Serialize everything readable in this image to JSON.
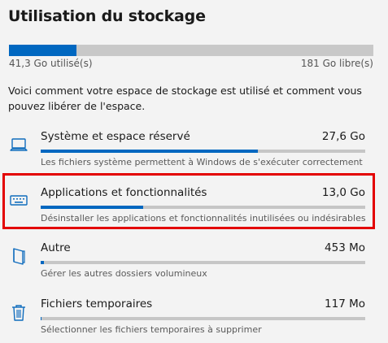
{
  "title": "Utilisation du stockage",
  "storage": {
    "used_label": "41,3 Go utilisé(s)",
    "free_label": "181 Go libre(s)",
    "used_fraction": 0.186
  },
  "description": "Voici comment votre espace de stockage est utilisé et comment vous pouvez libérer de l'espace.",
  "categories": [
    {
      "name": "Système et espace réservé",
      "size": "27,6 Go",
      "subtitle": "Les fichiers système permettent à Windows de s'exécuter correctement",
      "fraction": 0.67,
      "icon": "laptop-icon"
    },
    {
      "name": "Applications et fonctionnalités",
      "size": "13,0 Go",
      "subtitle": "Désinstaller les applications et fonctionnalités inutilisées ou indésirables",
      "fraction": 0.315,
      "icon": "keyboard-icon"
    },
    {
      "name": "Autre",
      "size": "453 Mo",
      "subtitle": "Gérer les autres dossiers volumineux",
      "fraction": 0.011,
      "icon": "folder-icon"
    },
    {
      "name": "Fichiers temporaires",
      "size": "117 Mo",
      "subtitle": "Sélectionner les fichiers temporaires à supprimer",
      "fraction": 0.003,
      "icon": "trash-icon"
    }
  ],
  "colors": {
    "accent": "#0067c0",
    "highlight": "#e30000"
  }
}
